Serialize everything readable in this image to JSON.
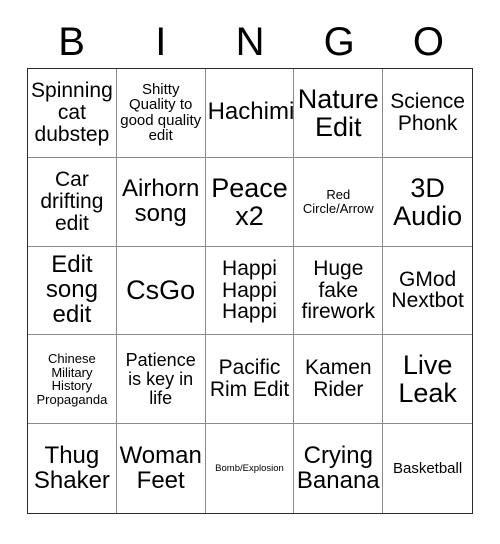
{
  "card": {
    "headers": [
      "B",
      "I",
      "N",
      "G",
      "O"
    ],
    "cells": [
      {
        "text": "Spinning cat dubstep",
        "size": "lg"
      },
      {
        "text": "Shitty Quality to good quality edit",
        "size": "sm"
      },
      {
        "text": "Hachimi",
        "size": "xl"
      },
      {
        "text": "Nature Edit",
        "size": "xxl"
      },
      {
        "text": "Science Phonk",
        "size": "lg"
      },
      {
        "text": "Car drifting edit",
        "size": "lg"
      },
      {
        "text": "Airhorn song",
        "size": "xl"
      },
      {
        "text": "Peace x2",
        "size": "xxl"
      },
      {
        "text": "Red Circle/Arrow",
        "size": "xs"
      },
      {
        "text": "3D Audio",
        "size": "xxl"
      },
      {
        "text": "Edit song edit",
        "size": "xl"
      },
      {
        "text": "CsGo",
        "size": "xxl"
      },
      {
        "text": "Happi Happi Happi",
        "size": "lg"
      },
      {
        "text": "Huge fake firework",
        "size": "lg"
      },
      {
        "text": "GMod Nextbot",
        "size": "lg"
      },
      {
        "text": "Chinese Military History Propaganda",
        "size": "xs"
      },
      {
        "text": "Patience is key in life",
        "size": "md"
      },
      {
        "text": "Pacific Rim Edit",
        "size": "lg"
      },
      {
        "text": "Kamen Rider",
        "size": "lg"
      },
      {
        "text": "Live Leak",
        "size": "xxl"
      },
      {
        "text": "Thug Shaker",
        "size": "xl"
      },
      {
        "text": "Woman Feet",
        "size": "xl"
      },
      {
        "text": "Bomb/Explosion",
        "size": "xxs"
      },
      {
        "text": "Crying Banana",
        "size": "xl"
      },
      {
        "text": "Basketball",
        "size": "sm"
      }
    ]
  }
}
